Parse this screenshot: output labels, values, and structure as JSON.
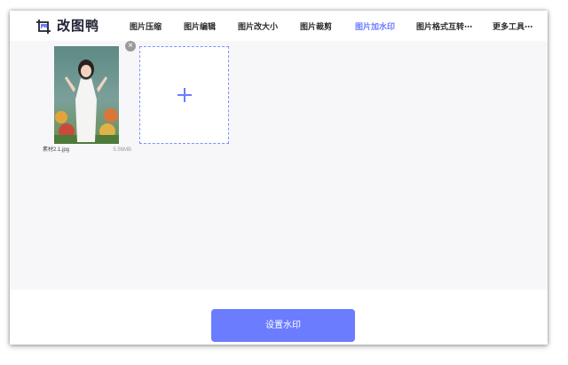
{
  "app": {
    "name": "改图鸭",
    "accent_color": "#6b7cff"
  },
  "nav": {
    "items": [
      {
        "label": "图片压缩"
      },
      {
        "label": "图片编辑"
      },
      {
        "label": "图片改大小"
      },
      {
        "label": "图片裁剪"
      },
      {
        "label": "图片加水印",
        "active": true
      },
      {
        "label": "图片格式互转⋯"
      },
      {
        "label": "更多工具⋯"
      }
    ]
  },
  "files": [
    {
      "name": "素材2.1.jpg",
      "size": "5.56MB",
      "thumbnail": "photo-of-woman-in-white-dress"
    }
  ],
  "upload": {
    "icon": "plus-icon"
  },
  "actions": {
    "primary_label": "设置水印"
  }
}
